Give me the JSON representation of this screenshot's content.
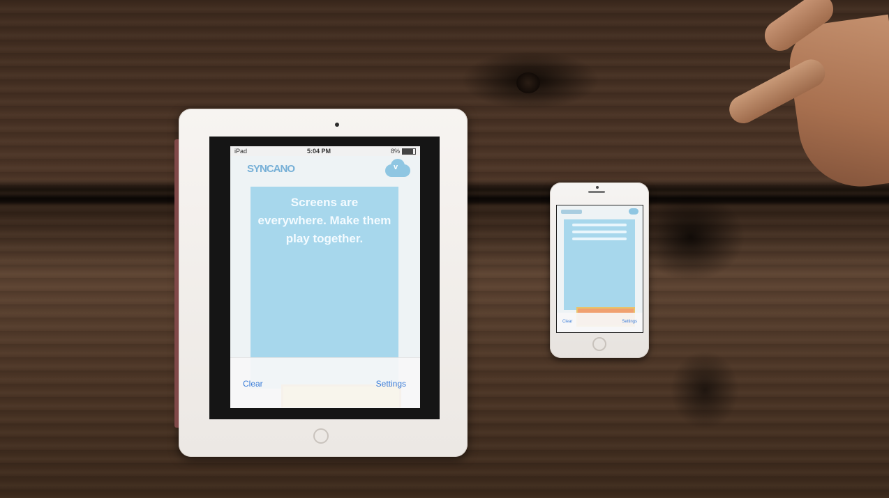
{
  "ipad": {
    "status": {
      "left": "iPad",
      "time": "5:04 PM",
      "battery": "8%"
    },
    "logo": "SYNCANO",
    "hero_title": "Screens are everywhere. Make them play together.",
    "toolbar": {
      "clear_label": "Clear",
      "settings_label": "Settings"
    }
  },
  "iphone": {
    "toolbar": {
      "clear_label": "Clear",
      "settings_label": "Settings"
    }
  },
  "colors": {
    "hero": "#a7d7ec",
    "link": "#3b7dd8",
    "wood": "#4b3426"
  },
  "icons": [
    "cloud-chevron-icon",
    "wifi-icon",
    "battery-icon"
  ]
}
